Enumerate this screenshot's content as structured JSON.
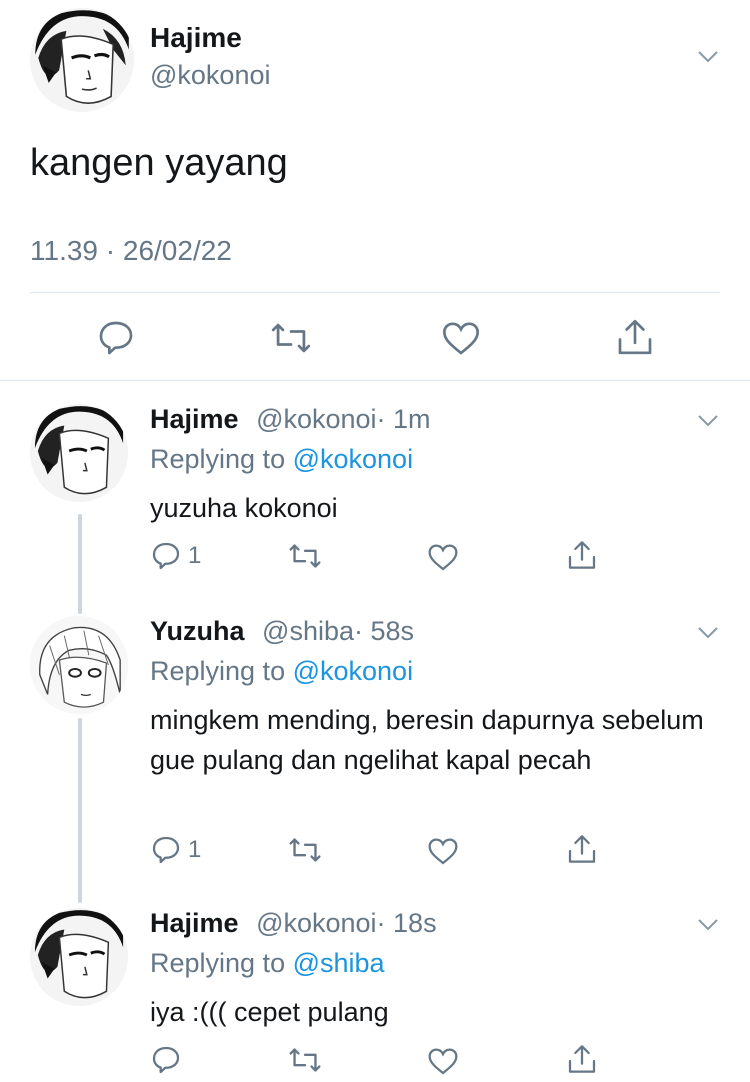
{
  "main_tweet": {
    "display_name": "Hajime",
    "handle": "@kokonoi",
    "text": "kangen yayang",
    "timestamp": "11.39 · 26/02/22",
    "icons": [
      "reply-icon",
      "retweet-icon",
      "like-icon",
      "share-icon"
    ]
  },
  "replies": [
    {
      "display_name": "Hajime",
      "handle": "@kokonoi",
      "time": "· 1m",
      "replying_prefix": "Replying to ",
      "replying_to": "@kokonoi",
      "text": "yuzuha kokonoi",
      "reply_count": "1"
    },
    {
      "display_name": "Yuzuha",
      "handle": "@shiba",
      "time": "· 58s",
      "replying_prefix": "Replying to ",
      "replying_to": "@kokonoi",
      "text": "mingkem mending, beresin dapurnya sebelum gue pulang dan ngelihat kapal pecah",
      "reply_count": "1"
    },
    {
      "display_name": "Hajime",
      "handle": "@kokonoi",
      "time": "· 18s",
      "replying_prefix": "Replying to ",
      "replying_to": "@shiba",
      "text": "iya :((( cepet pulang",
      "reply_count": ""
    }
  ],
  "colors": {
    "text": "#14171a",
    "muted": "#657786",
    "link": "#1b95e0",
    "divider": "#e1e8ed",
    "thread_line": "#ccd6dd"
  }
}
